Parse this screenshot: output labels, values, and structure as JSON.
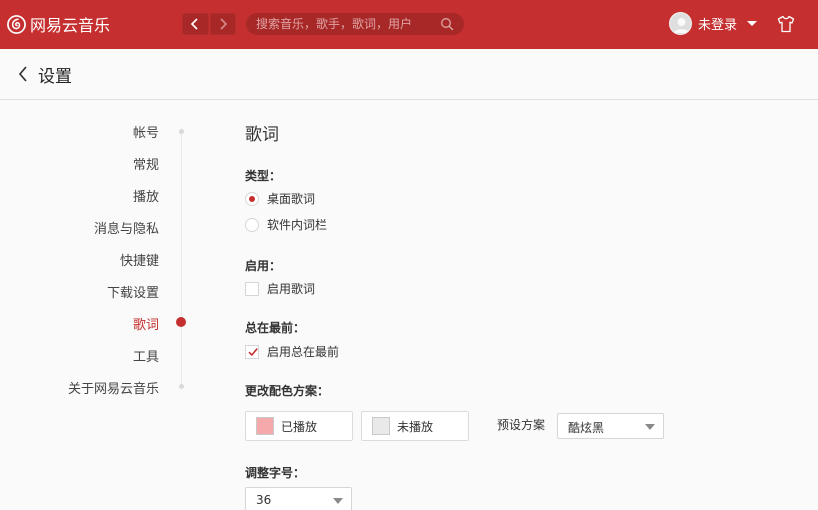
{
  "app": {
    "name": "网易云音乐"
  },
  "search": {
    "placeholder": "搜索音乐，歌手，歌词，用户"
  },
  "user": {
    "name": "未登录"
  },
  "header": {
    "title": "设置"
  },
  "sidebar": {
    "items": [
      {
        "label": "帐号"
      },
      {
        "label": "常规"
      },
      {
        "label": "播放"
      },
      {
        "label": "消息与隐私"
      },
      {
        "label": "快捷键"
      },
      {
        "label": "下载设置"
      },
      {
        "label": "歌词",
        "active": true
      },
      {
        "label": "工具"
      },
      {
        "label": "关于网易云音乐"
      }
    ]
  },
  "section": {
    "title": "歌词",
    "type": {
      "label": "类型：",
      "options": [
        {
          "label": "桌面歌词",
          "selected": true
        },
        {
          "label": "软件内词栏",
          "selected": false
        }
      ]
    },
    "enable": {
      "label": "启用：",
      "option": "启用歌词",
      "checked": false
    },
    "ontop": {
      "label": "总在最前：",
      "option": "启用总在最前",
      "checked": true
    },
    "scheme": {
      "label": "更改配色方案：",
      "played": {
        "label": "已播放",
        "color": "#f5a9ab"
      },
      "unplayed": {
        "label": "未播放",
        "color": "#e9e9e9"
      },
      "preset_label": "预设方案",
      "preset_value": "酷炫黑"
    },
    "fontsize": {
      "label": "调整字号：",
      "value": "36"
    }
  },
  "colors": {
    "brand": "#c62f2f",
    "accent": "#c62f2f"
  }
}
